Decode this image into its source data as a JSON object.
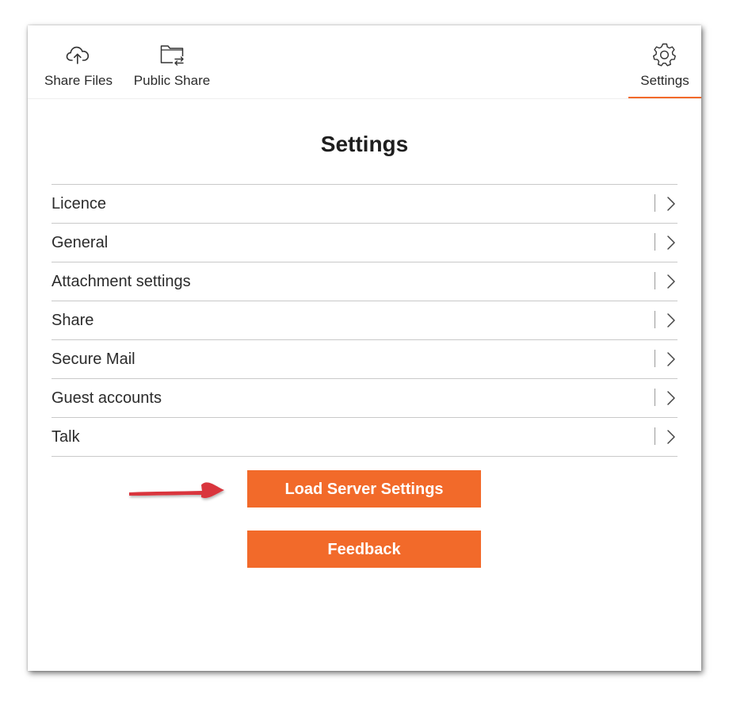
{
  "nav": {
    "tabs": [
      {
        "label": "Share Files",
        "icon": "cloud-upload-icon"
      },
      {
        "label": "Public Share",
        "icon": "folder-share-icon"
      },
      {
        "label": "Settings",
        "icon": "gear-icon",
        "active": true
      }
    ]
  },
  "page": {
    "title": "Settings"
  },
  "settings_list": [
    {
      "label": "Licence"
    },
    {
      "label": "General"
    },
    {
      "label": "Attachment settings"
    },
    {
      "label": "Share"
    },
    {
      "label": "Secure Mail"
    },
    {
      "label": "Guest accounts"
    },
    {
      "label": "Talk"
    }
  ],
  "buttons": {
    "load_server_settings": "Load Server Settings",
    "feedback": "Feedback"
  },
  "colors": {
    "accent": "#f26a2a",
    "annotation_arrow": "#d9363e",
    "text": "#2b2b2b",
    "divider": "#c9c9c9"
  }
}
